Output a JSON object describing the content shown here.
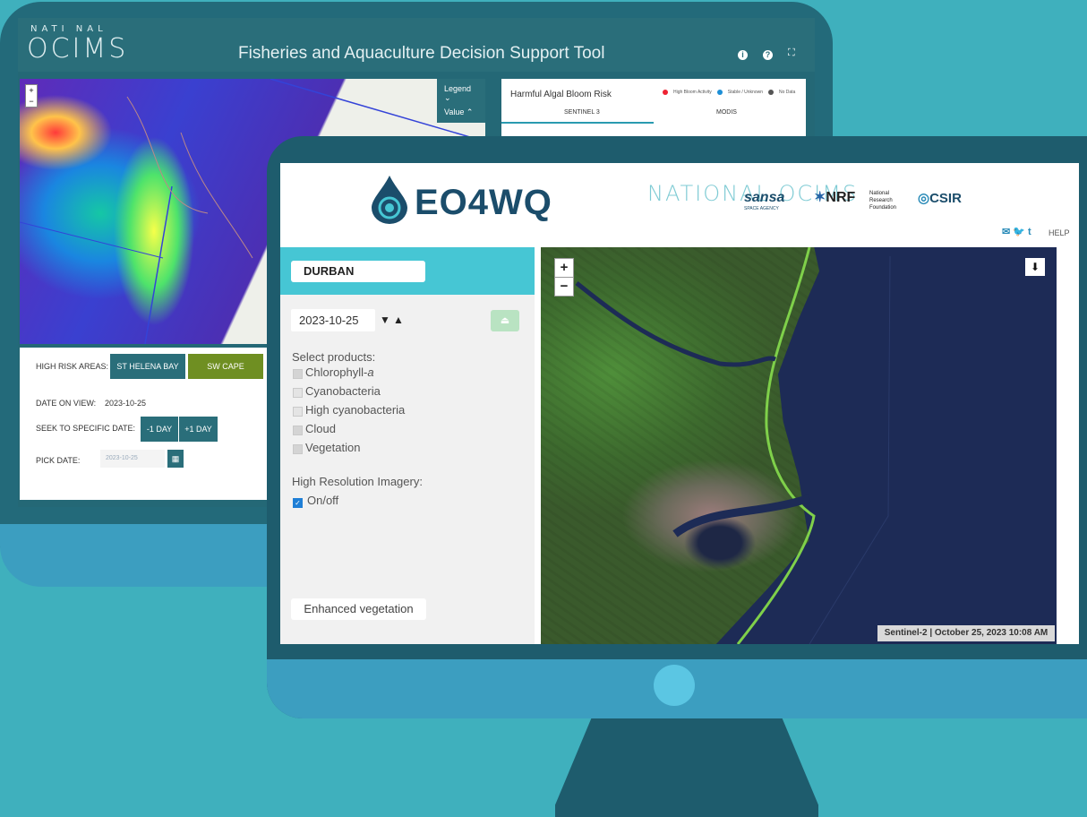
{
  "back_window": {
    "logo_top": "NATI NAL",
    "logo_bottom": "OCIMS",
    "title": "Fisheries and Aquaculture Decision Support Tool",
    "header_icons": [
      "info-icon",
      "help-icon",
      "fullscreen-icon"
    ],
    "map_zoom_in": "+",
    "map_zoom_out": "−",
    "legend_label": "Legend",
    "value_label": "Value",
    "hab_panel": {
      "title": "Harmful Algal Bloom Risk",
      "legend": [
        "High Bloom Activity",
        "Stable / Unknown",
        "No Data"
      ],
      "tabs": [
        "SENTINEL 3",
        "MODIS"
      ]
    },
    "controls": {
      "high_risk_label": "HIGH RISK AREAS:",
      "areas": [
        "ST HELENA BAY",
        "SW CAPE"
      ],
      "date_on_view_label": "DATE ON VIEW:",
      "date_on_view": "2023-10-25",
      "seek_label": "SEEK TO SPECIFIC DATE:",
      "minus_day": "-1 DAY",
      "plus_day": "+1 DAY",
      "pick_label": "PICK DATE:",
      "pick_value": "2023-10-25"
    }
  },
  "front_window": {
    "app_name": "EO4WQ",
    "partner_logos": [
      "NATIONAL OCIMS",
      "sansa",
      "NRF",
      "National Research Foundation",
      "CSIR"
    ],
    "sansa_sub": "SPACE AGENCY",
    "social_icons": [
      "mail-icon",
      "twitter-icon",
      "tumblr-icon"
    ],
    "help": "HELP",
    "location": "DURBAN",
    "date": "2023-10-25",
    "date_down": "▼",
    "date_up": "▲",
    "download_icon": "download-icon",
    "select_products_label": "Select products:",
    "products": [
      {
        "label": "Chlorophyll-",
        "italic_suffix": "a",
        "checked": true
      },
      {
        "label": "Cyanobacteria",
        "checked": false
      },
      {
        "label": "High cyanobacteria",
        "checked": false
      },
      {
        "label": "Cloud",
        "checked": true
      },
      {
        "label": "Vegetation",
        "checked": true
      }
    ],
    "high_res_label": "High Resolution Imagery:",
    "onoff_label": "On/off",
    "onoff_checked": true,
    "enhanced_button": "Enhanced vegetation",
    "map_zoom_in": "+",
    "map_zoom_out": "−",
    "attribution": "Sentinel-2 | October 25, 2023 10:08 AM"
  },
  "colors": {
    "background": "#3fb0bd",
    "monitor_dark": "#1e5c6d",
    "monitor_bezel": "#3c9ec0",
    "accent_teal": "#46c6d4",
    "ocims_teal": "#2a6e7a",
    "eo4wq_blue": "#1b4d6b"
  }
}
